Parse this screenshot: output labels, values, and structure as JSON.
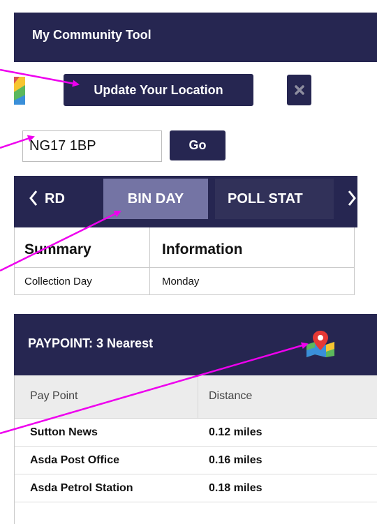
{
  "header": {
    "title": "My Community Tool"
  },
  "location": {
    "update_label": "Update Your Location",
    "postcode_value": "NG17 1BP",
    "go_label": "Go"
  },
  "tabs": {
    "items": [
      {
        "label": "RD"
      },
      {
        "label": "BIN DAY",
        "active": true
      },
      {
        "label": "POLL STAT"
      }
    ]
  },
  "summary_table": {
    "headers": [
      "Summary",
      "Information"
    ],
    "rows": [
      [
        "Collection Day",
        "Monday"
      ]
    ]
  },
  "paypoint": {
    "title": "PAYPOINT: 3 Nearest",
    "headers": [
      "Pay Point",
      "Distance"
    ],
    "rows": [
      [
        "Sutton News",
        "0.12 miles"
      ],
      [
        "Asda Post Office",
        "0.16 miles"
      ],
      [
        "Asda Petrol Station",
        "0.18 miles"
      ]
    ]
  },
  "colors": {
    "brand_navy": "#262651",
    "active_tab": "#7474a4",
    "annotation_arrow": "#ee00ee"
  },
  "icons": [
    "map-icon",
    "close-icon",
    "chevron-left-icon",
    "chevron-right-icon",
    "map-pin-icon"
  ]
}
